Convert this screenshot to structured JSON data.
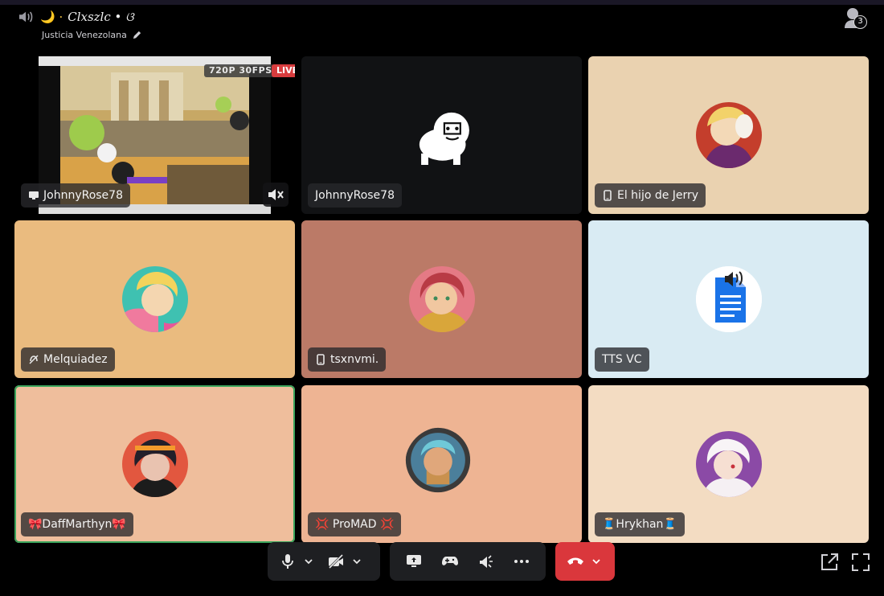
{
  "header": {
    "channel_title": "𝐶𝑙𝑥𝑠𝑧𝑙𝑐 • ଓ",
    "channel_emoji": "🌙 ·",
    "channel_subtitle": "Justicia Venezolana",
    "participant_count": "3"
  },
  "tiles": [
    {
      "name": "JohnnyRose78",
      "type": "stream",
      "quality": "720P 30FPS",
      "live_label": "LIVE",
      "status_icon": "screen-icon"
    },
    {
      "name": "JohnnyRose78",
      "type": "avatar",
      "bg": "#111214"
    },
    {
      "name": "El hijo de Jerry",
      "type": "avatar",
      "bg": "#ead2b0",
      "status_icon": "mobile-icon"
    },
    {
      "name": "Melquiadez",
      "type": "avatar",
      "bg": "#eabb7f",
      "status_icon": "deafened-icon"
    },
    {
      "name": "tsxnvmi.",
      "type": "avatar",
      "bg": "#bb7a67",
      "status_icon": "mobile-icon"
    },
    {
      "name": "TTS VC",
      "type": "avatar",
      "bg": "#d9ebf3"
    },
    {
      "name": "🎀DaffMarthyn🎀",
      "type": "avatar",
      "bg": "#efbe9c",
      "speaking": true
    },
    {
      "name": "💢 ProMAD 💢",
      "type": "avatar",
      "bg": "#eeb493"
    },
    {
      "name": "🧵Hrykhan🧵",
      "type": "avatar",
      "bg": "#f3dcc2"
    }
  ],
  "colors": {
    "end_call": "#da373c",
    "speaking_ring": "#3ba55c",
    "live_badge": "#d83c3e"
  }
}
